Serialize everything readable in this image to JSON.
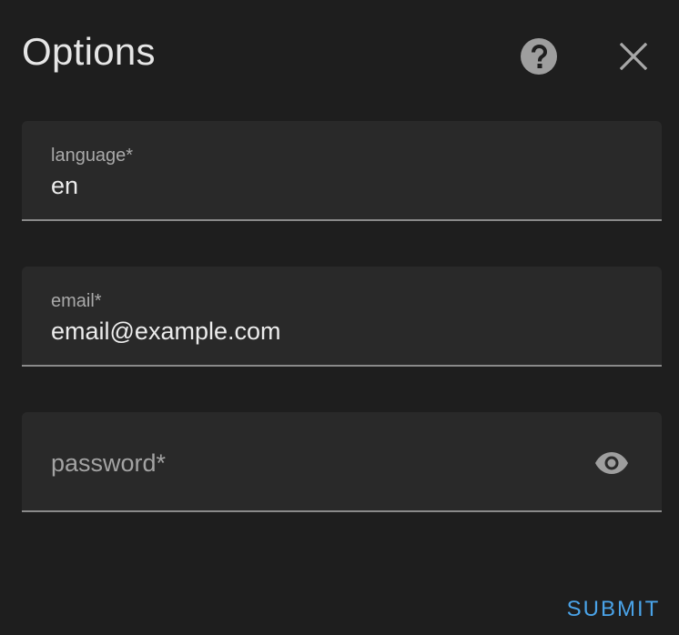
{
  "dialog": {
    "title": "Options",
    "help_icon": "help-circle-icon",
    "close_icon": "close-icon"
  },
  "form": {
    "language": {
      "label": "language*",
      "value": "en"
    },
    "email": {
      "label": "email*",
      "value": "email@example.com"
    },
    "password": {
      "placeholder": "password*",
      "value": "",
      "toggle_icon": "eye-icon"
    }
  },
  "actions": {
    "submit_label": "SUBMIT"
  },
  "colors": {
    "background": "#1e1e1e",
    "field_background": "#292929",
    "accent": "#4aa3e8",
    "icon": "#9e9e9e"
  }
}
